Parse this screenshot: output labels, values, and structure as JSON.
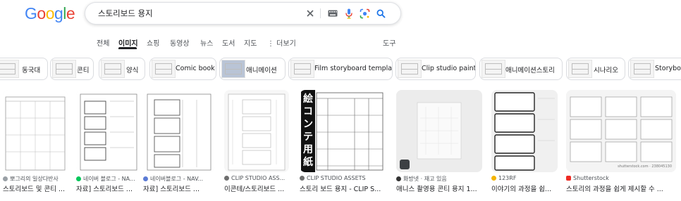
{
  "logo": {
    "letters": [
      "G",
      "o",
      "o",
      "g",
      "l",
      "e"
    ],
    "colors": [
      "#4285f4",
      "#ea4335",
      "#fbbc05",
      "#4285f4",
      "#34a853",
      "#ea4335"
    ]
  },
  "search": {
    "value": "스토리보드 용지"
  },
  "icons": {
    "clear": "close-icon",
    "keyboard": "keyboard-icon",
    "mic": "microphone-icon",
    "lens": "camera-lens-icon",
    "search": "search-icon"
  },
  "tabs": {
    "items": [
      "전체",
      "이미지",
      "쇼핑",
      "동영상",
      "뉴스",
      "도서",
      "지도",
      "⋮ 더보기"
    ],
    "active": "이미지",
    "tools": "도구"
  },
  "chips": [
    "동국대",
    "콘티",
    "양식",
    "Comic book",
    "애니메이션",
    "Film storyboard template",
    "Clip studio paint",
    "애니메이션스토리",
    "시나리오",
    "Storyboa"
  ],
  "results": [
    {
      "source": "뽀그리의 일상다반사",
      "title": "스토리보드 및 콘티 ..."
    },
    {
      "source": "네이버 블로그 - NA...",
      "title": "자료] 스토리보드 ..."
    },
    {
      "source": "네이버블로그 - NAV...",
      "title": "자료] 스토리보드 ..."
    },
    {
      "source": "CLIP STUDIO ASS...",
      "title": "이콘테/스토리보드 ..."
    },
    {
      "source": "CLIP STUDIO ASSETS",
      "title": "스토리 보드 용지 - CLIP S..."
    },
    {
      "source": "화방넷 · 재고 있음",
      "title": "애니스 촬영용 콘티 용지 1..."
    },
    {
      "source": "123RF",
      "title": "이야기의 과정을 쉽..."
    },
    {
      "source": "Shutterstock",
      "title": "스토리의 과정을 쉽게 제시할 수 ..."
    }
  ],
  "thumb_text": {
    "banner": "絵コンテ用紙",
    "watermark": "shutterstock.com · 238045130"
  },
  "colors": {
    "accent": "#1a73e8",
    "text": "#202124",
    "muted": "#4d5156",
    "border": "#dadce0"
  }
}
